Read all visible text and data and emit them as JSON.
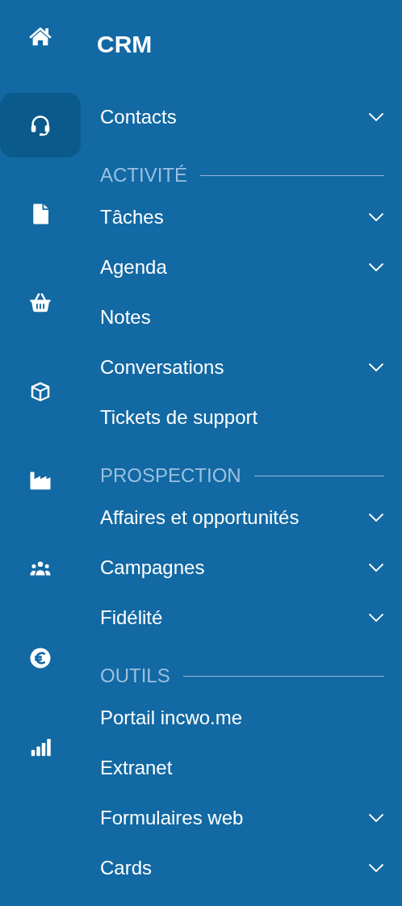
{
  "rail": [
    {
      "selected": false
    },
    {
      "selected": true
    },
    {
      "selected": false
    },
    {
      "selected": false
    },
    {
      "selected": false
    },
    {
      "selected": false
    },
    {
      "selected": false
    },
    {
      "selected": false
    },
    {
      "selected": false
    }
  ],
  "title": "CRM",
  "menu": [
    {
      "kind": "item",
      "label": "Contacts",
      "expandable": true
    },
    {
      "kind": "header",
      "label": "ACTIVITÉ"
    },
    {
      "kind": "item",
      "label": "Tâches",
      "expandable": true
    },
    {
      "kind": "item",
      "label": "Agenda",
      "expandable": true
    },
    {
      "kind": "item",
      "label": "Notes",
      "expandable": false
    },
    {
      "kind": "item",
      "label": "Conversations",
      "expandable": true
    },
    {
      "kind": "item",
      "label": "Tickets de support",
      "expandable": false
    },
    {
      "kind": "header",
      "label": "PROSPECTION"
    },
    {
      "kind": "item",
      "label": "Affaires et opportunités",
      "expandable": true
    },
    {
      "kind": "item",
      "label": "Campagnes",
      "expandable": true
    },
    {
      "kind": "item",
      "label": "Fidélité",
      "expandable": true
    },
    {
      "kind": "header",
      "label": "OUTILS"
    },
    {
      "kind": "item",
      "label": "Portail incwo.me",
      "expandable": false
    },
    {
      "kind": "item",
      "label": "Extranet",
      "expandable": false
    },
    {
      "kind": "item",
      "label": "Formulaires web",
      "expandable": true
    },
    {
      "kind": "item",
      "label": "Cards",
      "expandable": true
    }
  ]
}
